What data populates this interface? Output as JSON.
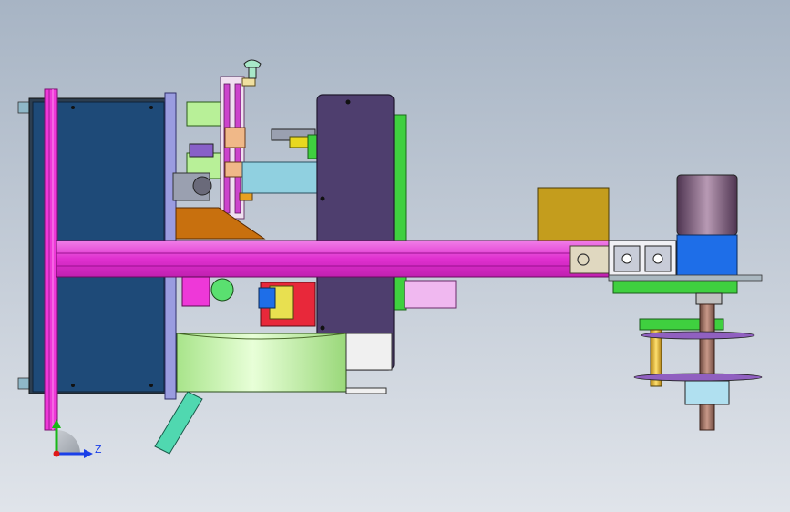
{
  "triad": {
    "z_label": "Z"
  },
  "colors": {
    "bg_top": "#a7b4c4",
    "bg_bottom": "#e0e4ea",
    "magenta_beam": "#ee38d8",
    "navy_panel": "#1e4a78",
    "purple_plate": "#4e3e6e",
    "green_part": "#3fd03f",
    "mustard_box": "#c49d1d",
    "blue_motor": "#1e6ee8",
    "motor_can": "#6e4f6a",
    "brown_wedge": "#c8700e",
    "drum_green": "#bff0a0",
    "teal_strut": "#50d8b0",
    "gold_pin": "#e8c020",
    "shaft_brown": "#9a6a5a",
    "axis_green": "#18b818",
    "axis_blue": "#1a3fe8",
    "axis_red": "#e01818"
  },
  "icons": [
    "knob-icon",
    "coordinate-triad-icon"
  ]
}
